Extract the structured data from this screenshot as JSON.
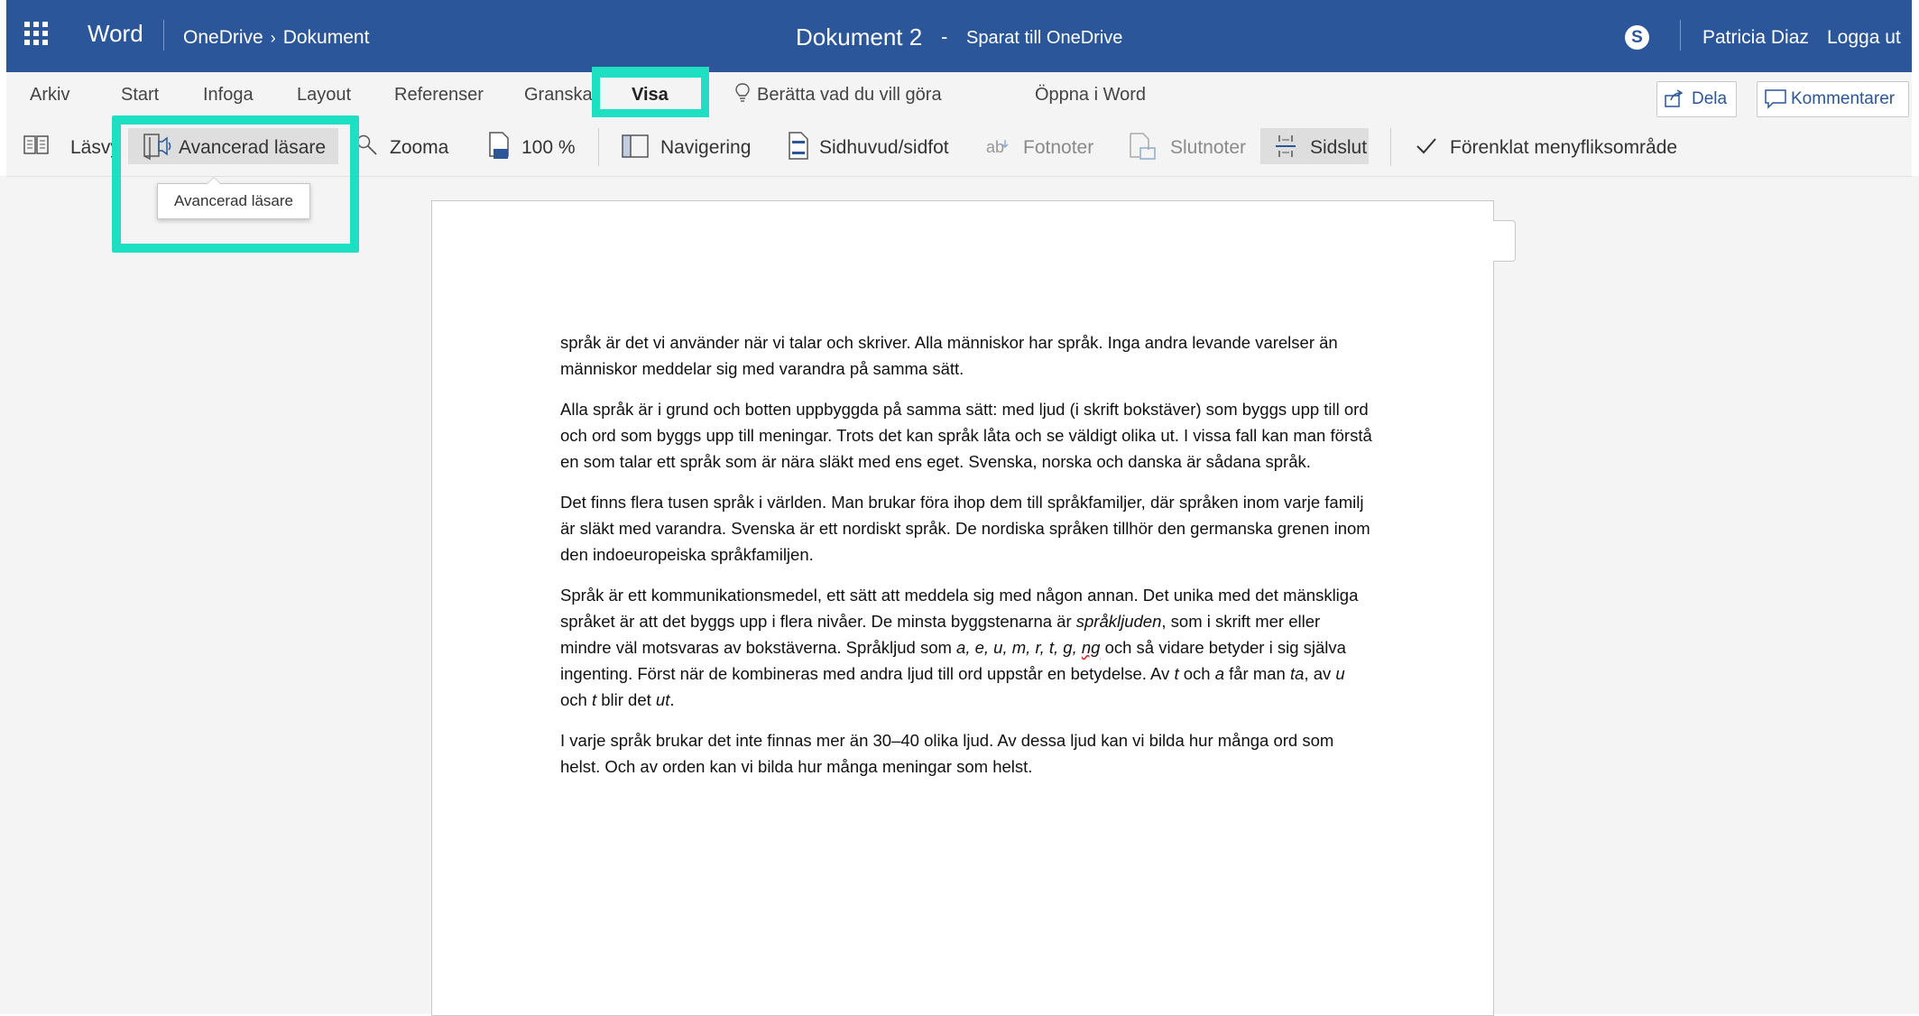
{
  "titlebar": {
    "app_name": "Word",
    "breadcrumb": [
      "OneDrive",
      "Dokument"
    ],
    "breadcrumb_sep": "›",
    "doc_title": "Dokument 2",
    "doc_dash": "-",
    "doc_status": "Sparat till OneDrive",
    "skype_glyph": "S",
    "user_name": "Patricia Diaz",
    "logout": "Logga ut"
  },
  "tabs": {
    "items": [
      "Arkiv",
      "Start",
      "Infoga",
      "Layout",
      "Referenser",
      "Granska",
      "Visa"
    ],
    "active": "Visa",
    "tell_me": "Berätta vad du vill göra",
    "open_in_word": "Öppna i Word",
    "share": "Dela",
    "comments": "Kommentarer"
  },
  "ribbon": {
    "reading_view": "Läsvy",
    "immersive_reader": "Avancerad läsare",
    "zoom": "Zooma",
    "zoom_100": "100 %",
    "navigation": "Navigering",
    "header_footer": "Sidhuvud/sidfot",
    "footnotes": "Fotnoter",
    "endnotes": "Slutnoter",
    "page_break": "Sidslut",
    "simplified_ribbon": "Förenklat menyfliksområde"
  },
  "tooltip": "Avancerad läsare",
  "colors": {
    "word_blue": "#2b579a",
    "highlight": "#1de0c2"
  },
  "document": {
    "p1": "språk är det vi använder när vi talar och skriver. Alla människor har språk. Inga andra levande varelser än människor meddelar sig med varandra på samma sätt.",
    "p2": "Alla språk är i grund och botten uppbyggda på samma sätt: med ljud (i skrift bokstäver) som byggs upp till ord och ord som byggs upp till meningar. Trots det kan språk låta och se väldigt olika ut. I vissa fall kan man förstå en som talar ett språk som är nära släkt med ens eget. Svenska, norska och danska är sådana språk.",
    "p3": "Det finns flera tusen språk i världen. Man brukar föra ihop dem till språkfamiljer, där språken inom varje familj är släkt med varandra. Svenska är ett nordiskt språk. De nordiska språken tillhör den germanska grenen inom den indoeuropeiska språkfamiljen.",
    "p4": {
      "a": "Språk är ett kommunikationsmedel, ett sätt att meddela sig med någon annan. Det unika med det mänskliga språket är att det byggs upp i flera nivåer. De minsta byggstenarna är ",
      "b": "språkljuden",
      "c": ", som i skrift mer eller mindre väl motsvaras av bokstäverna. Språkljud som ",
      "d": "a, e, u, m, r, t, g, ",
      "e": "ng",
      "f": " och så vidare betyder i sig själva ingenting. Först när de kombineras med andra ljud till ord uppstår en betydelse. Av ",
      "g": "t",
      "h": " och ",
      "i": "a",
      "j": " får man ",
      "k": "ta",
      "l": ", av ",
      "m": "u",
      "n": " och ",
      "o": "t",
      "p": " blir det ",
      "q": "ut",
      "r": "."
    },
    "p5": "I varje språk brukar det inte finnas mer än 30–40 olika ljud. Av dessa ljud kan vi bilda hur många ord som helst. Och av orden kan vi bilda hur många meningar som helst."
  }
}
